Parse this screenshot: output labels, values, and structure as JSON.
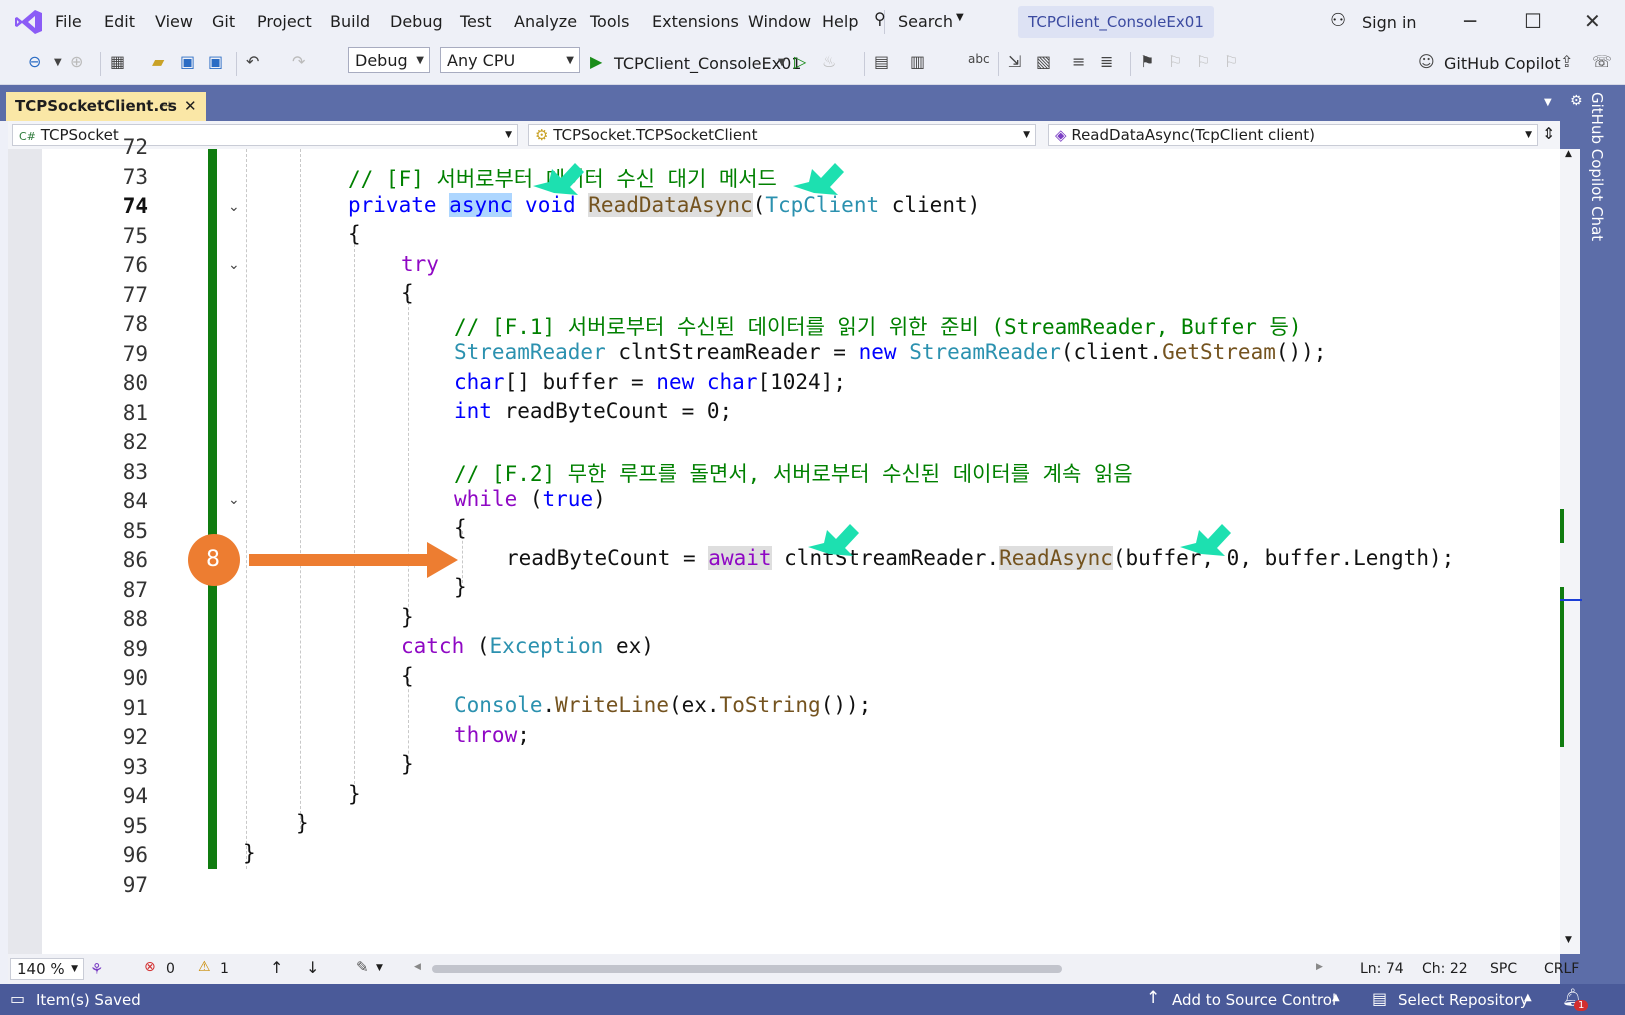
{
  "titlebar": {
    "menu": [
      "File",
      "Edit",
      "View",
      "Git",
      "Project",
      "Build",
      "Debug",
      "Test",
      "Analyze",
      "Tools",
      "Extensions",
      "Window",
      "Help"
    ],
    "search_label": "Search",
    "project_title": "TCPClient_ConsoleEx01",
    "signin_label": "Sign in"
  },
  "toolbar": {
    "config": "Debug",
    "platform": "Any CPU",
    "run_target": "TCPClient_ConsoleEx01",
    "copilot_label": "GitHub Copilot"
  },
  "tabs": [
    {
      "label": "TCPSocketClient.cs",
      "pin": "⊣",
      "close": "✕"
    }
  ],
  "navbar": {
    "project": "TCPSocket",
    "class": "TCPSocket.TCPSocketClient",
    "member": "ReadDataAsync(TcpClient client)"
  },
  "line_numbers": [
    "72",
    "73",
    "74",
    "75",
    "76",
    "77",
    "78",
    "79",
    "80",
    "81",
    "82",
    "83",
    "84",
    "85",
    "86",
    "87",
    "88",
    "89",
    "90",
    "91",
    "92",
    "93",
    "94",
    "95",
    "96",
    "97"
  ],
  "current_line_number": "74",
  "code": {
    "l73": "// [F] 서버로부터 데이터 수신 대기 메서드",
    "l74_private": "private",
    "l74_async": "async",
    "l74_void": "void",
    "l74_method": "ReadDataAsync",
    "l74_type": "TcpClient",
    "l74_param": " client)",
    "l75": "{",
    "l76": "try",
    "l77": "{",
    "l78": "// [F.1] 서버로부터 수신된 데이터를 읽기 위한 준비 (StreamReader, Buffer 등)",
    "l79_type": "StreamReader",
    "l79_a": " clntStreamReader = ",
    "l79_new": "new",
    "l79_type2": "StreamReader",
    "l79_b": "(client.",
    "l79_method": "GetStream",
    "l79_c": "());",
    "l80_char": "char",
    "l80_a": "[] buffer = ",
    "l80_new": "new",
    "l80_char2": "char",
    "l80_b": "[1024];",
    "l81_int": "int",
    "l81_a": " readByteCount = 0;",
    "l83": "// [F.2] 무한 루프를 돌면서, 서버로부터 수신된 데이터를 계속 읽음",
    "l84_while": "while",
    "l84_a": " (",
    "l84_true": "true",
    "l84_b": ")",
    "l85": "{",
    "l86_a": "readByteCount = ",
    "l86_await": "await",
    "l86_b": " clntStreamReader.",
    "l86_method": "ReadAsync",
    "l86_c": "(buffer, 0, buffer.Length);",
    "l87": "}",
    "l88": "}",
    "l89_catch": "catch",
    "l89_a": " (",
    "l89_type": "Exception",
    "l89_b": " ex)",
    "l90": "{",
    "l91_type": "Console",
    "l91_a": ".",
    "l91_method": "WriteLine",
    "l91_b": "(ex.",
    "l91_method2": "ToString",
    "l91_c": "());",
    "l92_throw": "throw",
    "l92_a": ";",
    "l93": "}",
    "l94": "}",
    "l95": "}",
    "l96": "}"
  },
  "annotation": {
    "step_number": "8",
    "color": "#ed7d31",
    "arrow_color": "#1de0b0"
  },
  "status": {
    "zoom": "140 %",
    "errors": "0",
    "warnings": "1",
    "line": "Ln: 74",
    "col": "Ch: 22",
    "spacing": "SPC",
    "eol": "CRLF",
    "saved": "Item(s) Saved",
    "source_control": "Add to Source Control",
    "repository": "Select Repository",
    "notifications": "1"
  },
  "side_panel_label": "GitHub Copilot Chat",
  "colors": {
    "accent": "#5c6da8",
    "statusbar": "#4a5a99",
    "tab_active": "#fae7a6",
    "change_bar": "#107c10"
  }
}
